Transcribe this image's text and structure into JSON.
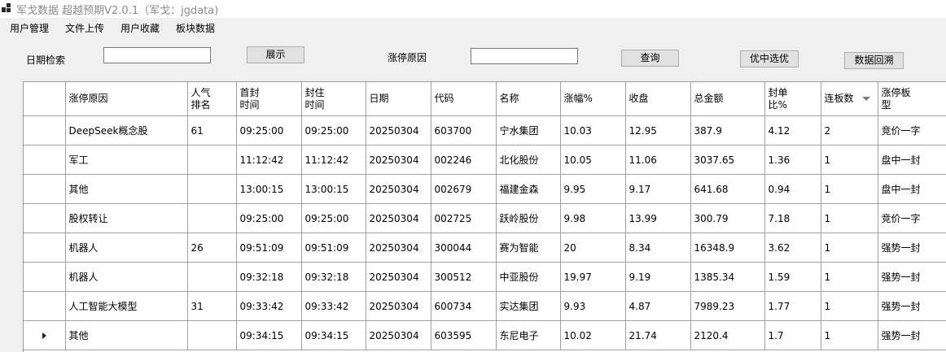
{
  "window": {
    "title": "军戈数据 超越预期V2.0.1（军戈：jgdata)"
  },
  "menu": [
    "用户管理",
    "文件上传",
    "用户收藏",
    "板块数据"
  ],
  "toolbar": {
    "date_label": "日期检索",
    "date_value": "",
    "show_button": "展示",
    "reason_label": "涨停原因",
    "reason_value": "",
    "query_button": "查询",
    "pick_button": "优中选优",
    "backtrack_button": "数据回溯"
  },
  "table": {
    "columns": [
      "涨停原因",
      "人气排名",
      "首封时间",
      "封住时间",
      "日期",
      "代码",
      "名称",
      "涨幅%",
      "收盘",
      "总金额",
      "封单比%",
      "连板数",
      "涨停板型"
    ],
    "rows": [
      [
        "DeepSeek概念股",
        "61",
        "09:25:00",
        "09:25:00",
        "20250304",
        "603700",
        "宁水集团",
        "10.03",
        "12.95",
        "387.9",
        "4.12",
        "2",
        "竞价一字"
      ],
      [
        "军工",
        "",
        "11:12:42",
        "11:12:42",
        "20250304",
        "002246",
        "北化股份",
        "10.05",
        "11.06",
        "3037.65",
        "1.36",
        "1",
        "盘中一封"
      ],
      [
        "其他",
        "",
        "13:00:15",
        "13:00:15",
        "20250304",
        "002679",
        "福建金森",
        "9.95",
        "9.17",
        "641.68",
        "0.94",
        "1",
        "盘中一封"
      ],
      [
        "股权转让",
        "",
        "09:25:00",
        "09:25:00",
        "20250304",
        "002725",
        "跃岭股份",
        "9.98",
        "13.99",
        "300.79",
        "7.18",
        "1",
        "竞价一字"
      ],
      [
        "机器人",
        "26",
        "09:51:09",
        "09:51:09",
        "20250304",
        "300044",
        "赛为智能",
        "20",
        "8.34",
        "16348.9",
        "3.62",
        "1",
        "强势一封"
      ],
      [
        "机器人",
        "",
        "09:32:18",
        "09:32:18",
        "20250304",
        "300512",
        "中亚股份",
        "19.97",
        "9.19",
        "1385.34",
        "1.59",
        "1",
        "强势一封"
      ],
      [
        "人工智能大模型",
        "31",
        "09:33:42",
        "09:33:42",
        "20250304",
        "600734",
        "实达集团",
        "9.93",
        "4.87",
        "7989.23",
        "1.77",
        "1",
        "强势一封"
      ],
      [
        "其他",
        "",
        "09:34:15",
        "09:34:15",
        "20250304",
        "603595",
        "东尼电子",
        "10.02",
        "21.74",
        "2120.4",
        "1.7",
        "1",
        "强势一封"
      ]
    ],
    "current_row": 7,
    "sorted_column": "连板数"
  }
}
